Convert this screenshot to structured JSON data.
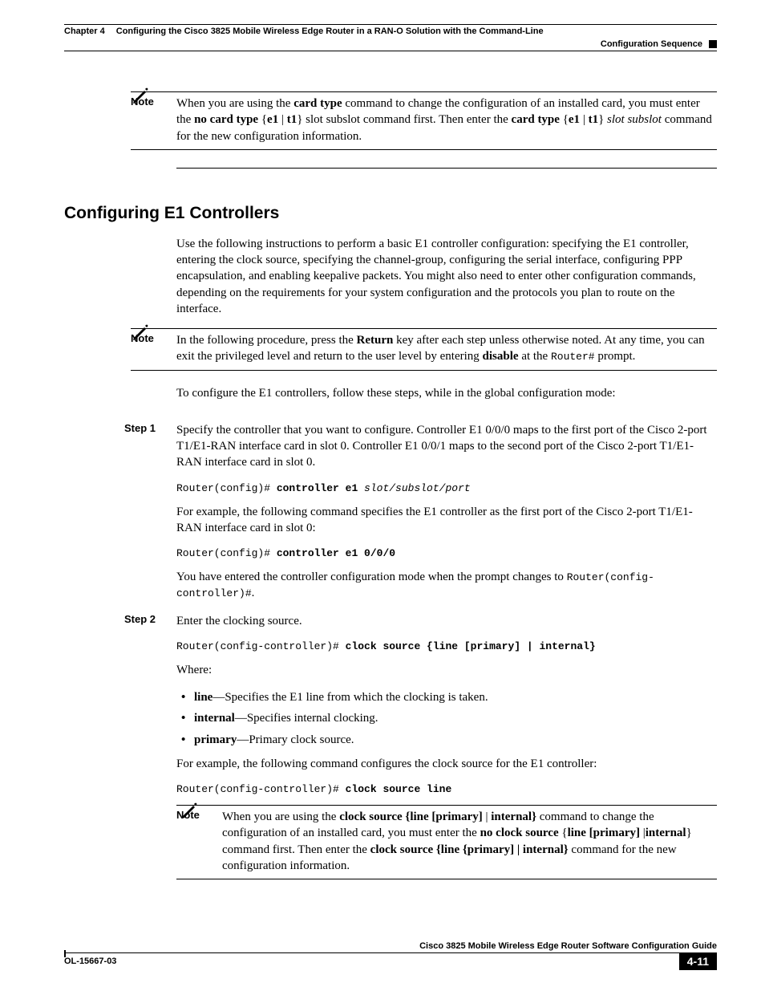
{
  "header": {
    "chapter": "Chapter 4",
    "title": "Configuring the Cisco 3825 Mobile Wireless Edge Router in a RAN-O Solution with the Command-Line",
    "section": "Configuration Sequence"
  },
  "note_top": {
    "label": "Note",
    "text_parts": [
      "When you are using the ",
      "card type",
      " command to change the configuration of an installed card, you must enter the ",
      "no card type",
      " {",
      "e1",
      " | ",
      "t1",
      "} slot subslot command first. Then enter the ",
      "card type",
      " {",
      "e1",
      " | ",
      "t1",
      "} ",
      "slot subslot",
      " command for the new configuration information."
    ]
  },
  "section": {
    "heading": "Configuring E1 Controllers",
    "intro": "Use the following instructions to perform a basic E1 controller configuration: specifying the E1 controller, entering the clock source, specifying the channel-group, configuring the serial interface, configuring PPP encapsulation, and enabling keepalive packets. You might also need to enter other configuration commands, depending on the requirements for your system configuration and the protocols you plan to route on the interface."
  },
  "note_mid": {
    "label": "Note",
    "parts": [
      "In the following procedure, press the ",
      "Return",
      " key after each step unless otherwise noted. At any time, you can exit the privileged level and return to the user level by entering ",
      "disable",
      " at the ",
      "Router#",
      " prompt."
    ]
  },
  "lead": "To configure the E1 controllers, follow these steps, while in the global configuration mode:",
  "step1": {
    "label": "Step 1",
    "para1": "Specify the controller that you want to configure. Controller E1 0/0/0 maps to the first port of the Cisco 2-port T1/E1-RAN interface card in slot 0. Controller E1 0/0/1 maps to the second port of the Cisco 2-port T1/E1-RAN interface card in slot 0.",
    "code1_prefix": "Router(config)# ",
    "code1_cmd": "controller e1 ",
    "code1_args": "slot/subslot/port",
    "para2": "For example, the following command specifies the E1 controller as the first port of the Cisco 2-port T1/E1-RAN interface card in slot 0:",
    "code2_prefix": "Router(config)# ",
    "code2_cmd": "controller e1 0/0/0",
    "para3_pre": "You have entered the controller configuration mode when the prompt changes to ",
    "para3_code": "Router(config-controller)#",
    "para3_post": "."
  },
  "step2": {
    "label": "Step 2",
    "para1": "Enter the clocking source.",
    "code1_prefix": "Router(config-controller)# ",
    "code1_cmd": "clock source {line [primary] | internal}",
    "where": "Where:",
    "bullets": {
      "b1_term": "line",
      "b1_desc": "—Specifies the E1 line from which the clocking is taken.",
      "b2_term": "internal",
      "b2_desc": "—Specifies internal clocking.",
      "b3_term": "primary",
      "b3_desc": "—Primary clock source."
    },
    "para2": "For example, the following command configures the clock source for the E1 controller:",
    "code2_prefix": "Router(config-controller)# ",
    "code2_cmd": "clock source line",
    "note": {
      "label": "Note",
      "parts": [
        "When you are using the ",
        "clock source {line [primary]",
        " | ",
        "internal}",
        " command to change the configuration of an installed card, you must enter the ",
        "no clock source",
        " {",
        "line [primary]",
        " |",
        "internal",
        "} command first. Then enter the ",
        "clock source {line {primary] | internal}",
        " command for the new configuration information."
      ]
    }
  },
  "footer": {
    "guide": "Cisco 3825 Mobile Wireless Edge Router Software Configuration Guide",
    "docnum": "OL-15667-03",
    "pagenum": "4-11"
  }
}
